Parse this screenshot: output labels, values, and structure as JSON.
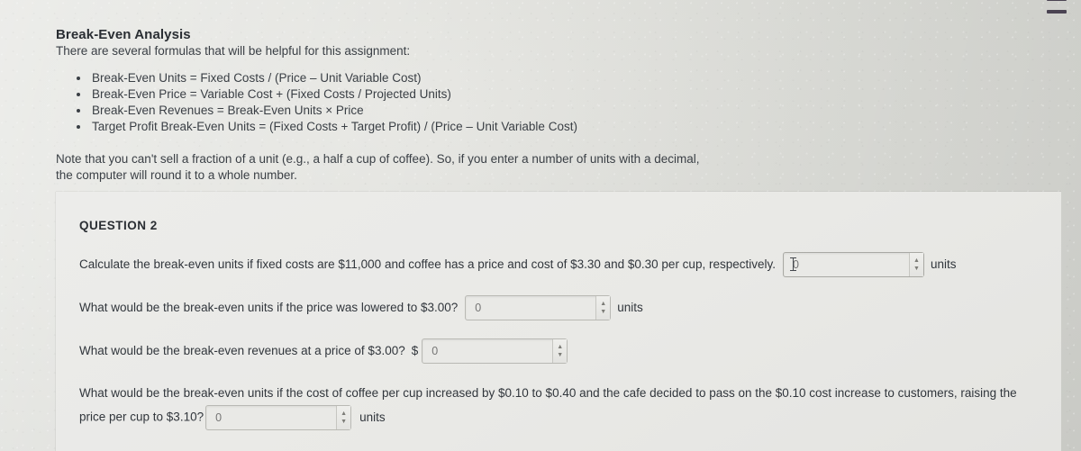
{
  "menu_icon": "hamburger-menu-icon",
  "intro": {
    "heading": "Break-Even Analysis",
    "subheading": "There are several formulas that will be helpful for this assignment:",
    "formulas": [
      "Break-Even Units = Fixed Costs / (Price – Unit Variable Cost)",
      "Break-Even Price = Variable Cost + (Fixed Costs / Projected Units)",
      "Break-Even Revenues = Break-Even Units × Price",
      "Target Profit Break-Even Units = (Fixed Costs + Target Profit) / (Price – Unit Variable Cost)"
    ],
    "note": "Note that you can't sell a fraction of a unit (e.g., a half a cup of coffee). So, if you enter a number of units with a decimal, the computer will round it to a whole number."
  },
  "question_card": {
    "title": "QUESTION 2",
    "rows": [
      {
        "lead": "Calculate the break-even units if fixed costs are $11,000 and coffee has a price and cost of $3.30 and $0.30 per cup, respectively.",
        "input_value": "0",
        "input_placeholder": "0",
        "trail": "units"
      },
      {
        "lead": "What would be the break-even units if the price was lowered to $3.00?",
        "input_value": "0",
        "input_placeholder": "0",
        "trail": "units"
      },
      {
        "lead": "What would be the break-even revenues at a price of $3.00?",
        "prefix": "$",
        "input_value": "0",
        "input_placeholder": "0",
        "trail": ""
      }
    ],
    "flow_question": {
      "text_before": "What would be the break-even units if the cost of coffee per cup increased by $0.10 to $0.40 and the cafe decided to pass on the $0.10 cost increase to customers, raising the price per cup to $3.10?",
      "input_value": "0",
      "input_placeholder": "0",
      "trail": "units"
    },
    "spinner_up_icon": "spinner-up-arrow-icon",
    "spinner_down_icon": "spinner-down-arrow-icon"
  }
}
